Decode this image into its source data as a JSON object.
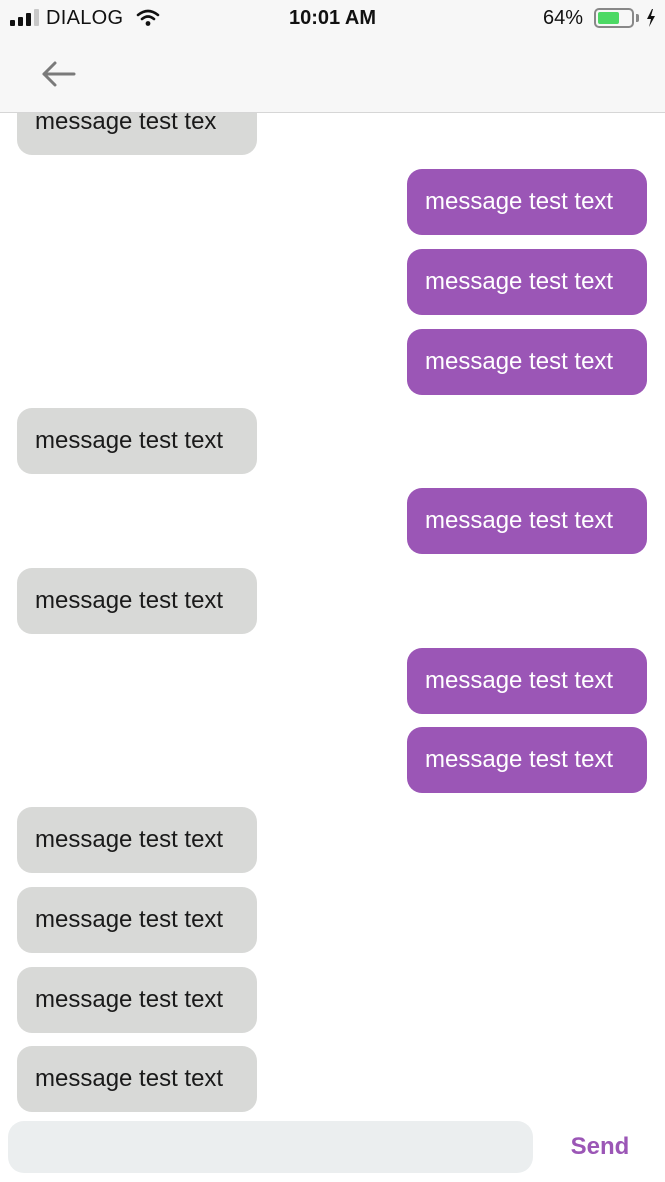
{
  "status_bar": {
    "carrier": "DIALOG",
    "time": "10:01 AM",
    "battery_percent": "64%",
    "battery_level": 0.64,
    "battery_color": "#4cd964"
  },
  "header": {
    "back_icon": "arrow-left-icon"
  },
  "theme": {
    "sent_bubble_color": "#9b56b6",
    "received_bubble_color": "#d8d9d7",
    "input_background": "#ebeeef"
  },
  "messages": [
    {
      "direction": "received",
      "text": "message test tex"
    },
    {
      "direction": "sent",
      "text": "message test text"
    },
    {
      "direction": "sent",
      "text": "message test text"
    },
    {
      "direction": "sent",
      "text": "message test text"
    },
    {
      "direction": "received",
      "text": "message test text"
    },
    {
      "direction": "sent",
      "text": "message test text"
    },
    {
      "direction": "received",
      "text": "message test text"
    },
    {
      "direction": "sent",
      "text": "message test text"
    },
    {
      "direction": "sent",
      "text": "message test text"
    },
    {
      "direction": "received",
      "text": "message test text"
    },
    {
      "direction": "received",
      "text": "message test text"
    },
    {
      "direction": "received",
      "text": "message test text"
    },
    {
      "direction": "received",
      "text": "message test text"
    }
  ],
  "composer": {
    "input_value": "",
    "send_label": "Send"
  }
}
